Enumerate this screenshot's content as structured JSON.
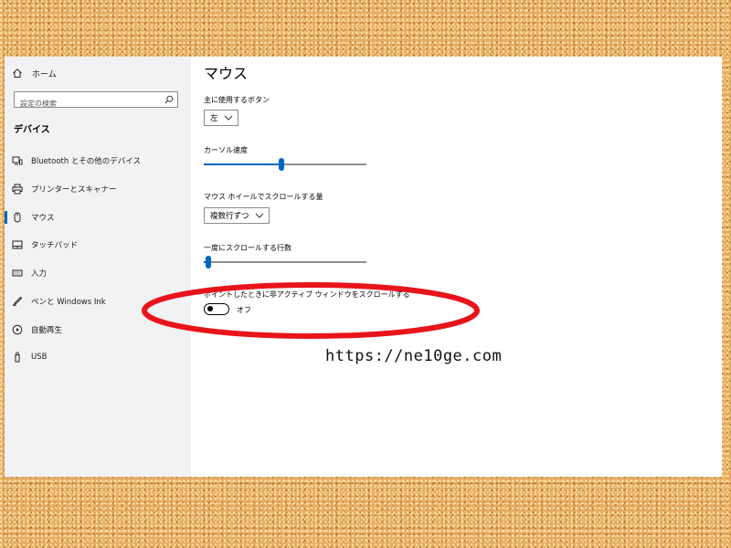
{
  "sidebar": {
    "home_label": "ホーム",
    "search_placeholder": "設定の検索",
    "section_title": "デバイス",
    "items": [
      {
        "label": "Bluetooth とその他のデバイス",
        "icon": "devices-icon"
      },
      {
        "label": "プリンターとスキャナー",
        "icon": "printer-icon"
      },
      {
        "label": "マウス",
        "icon": "mouse-icon",
        "active": true
      },
      {
        "label": "タッチパッド",
        "icon": "touchpad-icon"
      },
      {
        "label": "入力",
        "icon": "keyboard-icon"
      },
      {
        "label": "ペンと Windows Ink",
        "icon": "pen-icon"
      },
      {
        "label": "自動再生",
        "icon": "autoplay-icon"
      },
      {
        "label": "USB",
        "icon": "usb-icon"
      }
    ]
  },
  "main": {
    "title": "マウス",
    "primary_button": {
      "label": "主に使用するボタン",
      "value": "左"
    },
    "cursor_speed": {
      "label": "カーソル速度",
      "level": 0.48
    },
    "wheel_scroll": {
      "label": "マウス ホイールでスクロールする量",
      "value": "複数行ずつ"
    },
    "lines_per_scroll": {
      "label": "一度にスクロールする行数",
      "level": 0.03
    },
    "inactive_scroll": {
      "label": "ポイントしたときに非アクティブ ウィンドウをスクロールする",
      "state": "オフ",
      "on": false
    }
  },
  "annotation": {
    "url": "https://ne10ge.com",
    "ellipse_color": "#e8141b"
  },
  "colors": {
    "accent": "#0067c0",
    "sidebar_bg": "#f2f2f2",
    "background": "#e6ad62"
  }
}
